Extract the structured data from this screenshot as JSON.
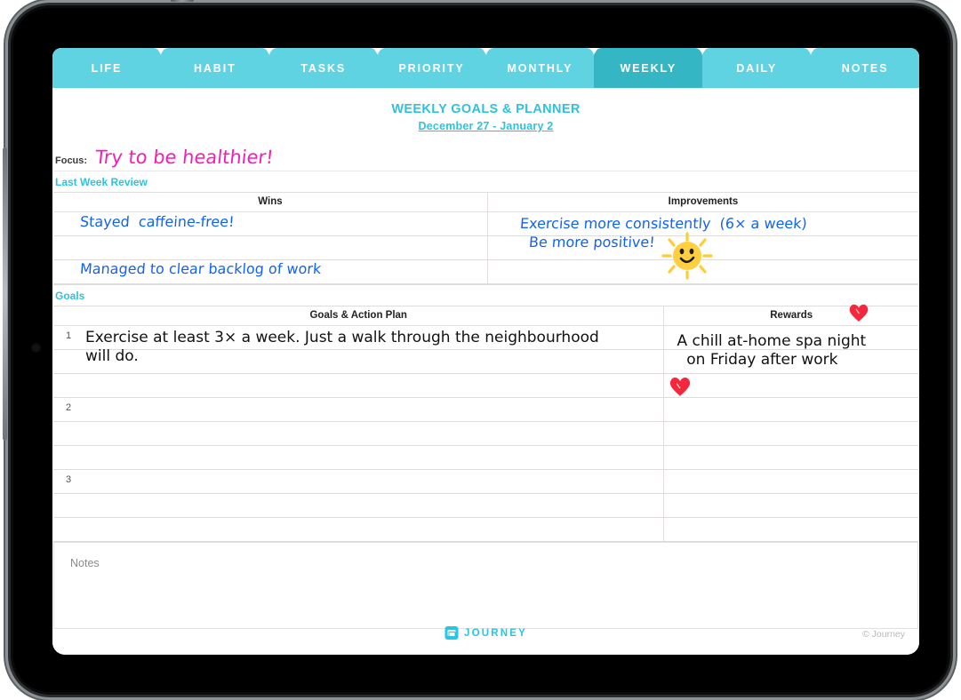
{
  "tabs": [
    {
      "label": "LIFE",
      "active": false
    },
    {
      "label": "HABIT",
      "active": false
    },
    {
      "label": "TASKS",
      "active": false
    },
    {
      "label": "PRIORITY",
      "active": false
    },
    {
      "label": "MONTHLY",
      "active": false
    },
    {
      "label": "WEEKLY",
      "active": true
    },
    {
      "label": "DAILY",
      "active": false
    },
    {
      "label": "NOTES",
      "active": false
    }
  ],
  "document": {
    "title": "WEEKLY GOALS & PLANNER",
    "date_range": "December 27 - January 2"
  },
  "focus": {
    "label": "Focus:",
    "value": "Try to be healthier!"
  },
  "last_week_review": {
    "section_label": "Last Week Review",
    "columns": [
      "Wins",
      "Improvements"
    ],
    "wins": [
      "Stayed  caffeine-free!",
      "Managed to clear backlog of work"
    ],
    "improvements": [
      "Exercise more consistently  (6× a week)",
      "Be more positive!"
    ]
  },
  "goals": {
    "section_label": "Goals",
    "columns": [
      "Goals & Action Plan",
      "Rewards"
    ],
    "rows": [
      {
        "number": "1",
        "plan": "Exercise at least 3× a week. Just a walk through the neighbourhood\nwill do.",
        "reward": "A chill at-home spa night\n  on Friday after work"
      },
      {
        "number": "2",
        "plan": "",
        "reward": ""
      },
      {
        "number": "3",
        "plan": "",
        "reward": ""
      }
    ]
  },
  "notes": {
    "placeholder": "Notes"
  },
  "footer": {
    "brand": "JOURNEY",
    "copyright": "© Journey"
  },
  "colors": {
    "tab_inactive": "#5fd3e2",
    "tab_active": "#35b6c4",
    "accent": "#2fc2dc",
    "focus_ink": "#f51fb5",
    "review_ink": "#1262f5",
    "goal_ink": "#111111",
    "heart": "#f5273d",
    "sun": "#ffcc33"
  }
}
